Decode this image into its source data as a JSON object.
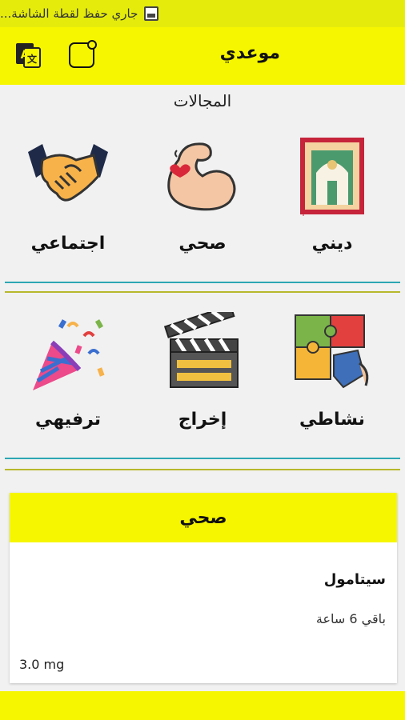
{
  "status_bar": {
    "text": "جاري حفظ لقطة الشاشة..."
  },
  "app_bar": {
    "title": "موعدي"
  },
  "section": {
    "title": "المجالات"
  },
  "categories": [
    {
      "label": "ديني",
      "icon": "prayer-rug-icon"
    },
    {
      "label": "صحي",
      "icon": "flexed-arm-icon"
    },
    {
      "label": "اجتماعي",
      "icon": "handshake-icon"
    },
    {
      "label": "نشاطي",
      "icon": "puzzle-icon"
    },
    {
      "label": "إخراج",
      "icon": "clapperboard-icon"
    },
    {
      "label": "ترفيهي",
      "icon": "party-popper-icon"
    }
  ],
  "card": {
    "header": "صحي",
    "name": "سيتامول",
    "remaining": "باقي 6 ساعة",
    "dose": "3.0 mg"
  },
  "colors": {
    "accent": "#f6f600",
    "teal": "#2ea7b4",
    "olive": "#b7b82b"
  }
}
